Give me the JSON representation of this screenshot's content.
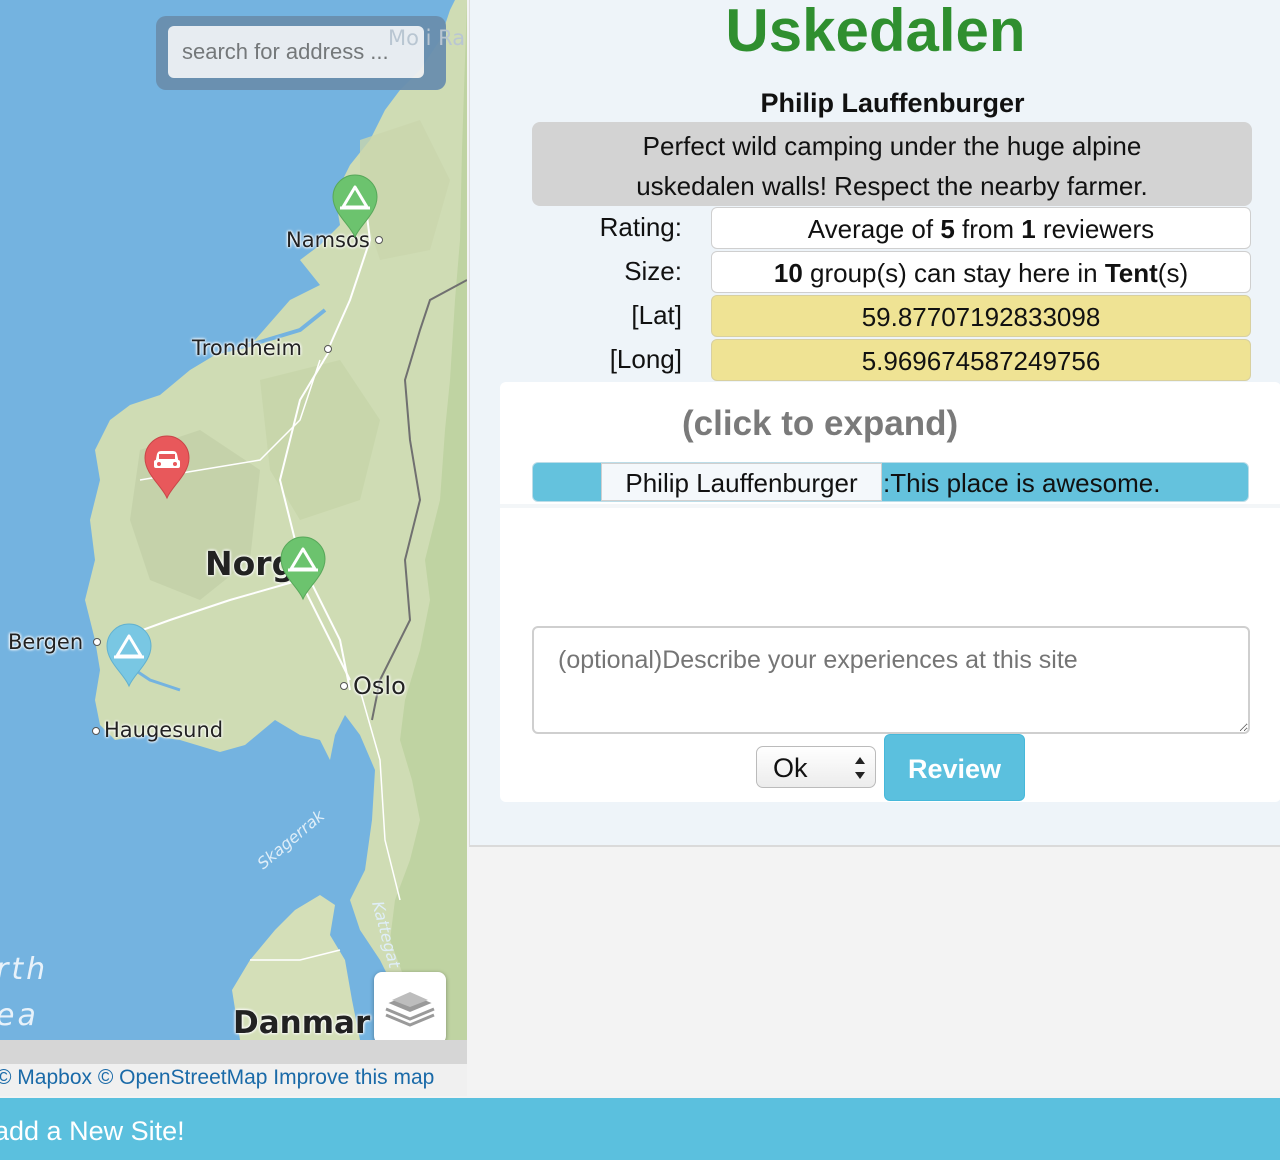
{
  "map": {
    "search_placeholder": "search for address ...",
    "labels": {
      "mo_i_ra": "Mo i Ra",
      "namsos": "Namsos",
      "trondheim": "Trondheim",
      "norge": "Norg",
      "bergen": "Bergen",
      "oslo": "Oslo",
      "haugesund": "Haugesund",
      "skagerrak": "Skagerrak",
      "kattegat": "Kattegat",
      "north": "rth",
      "sea": "ea",
      "danmark": "Danmar"
    },
    "markers": [
      {
        "name": "marker-namsos",
        "type": "tent-icon",
        "color": "#6cc36e"
      },
      {
        "name": "marker-uskedalen-selected",
        "type": "car-icon",
        "color": "#e8585b"
      },
      {
        "name": "marker-central",
        "type": "tent-icon",
        "color": "#6cc36e"
      },
      {
        "name": "marker-bergen",
        "type": "tent-icon",
        "color": "#79c7e3"
      }
    ],
    "attribution": {
      "mapbox": "© Mapbox",
      "osm": "© OpenStreetMap",
      "improve": "Improve this map"
    },
    "layers_icon": "layers-icon"
  },
  "site": {
    "title": "Uskedalen",
    "author": "Philip Lauffenburger",
    "description_line1": "Perfect wild camping under the huge alpine",
    "description_line2": "uskedalen walls! Respect the nearby farmer.",
    "rating_label": "Rating:",
    "rating_prefix": "Average of ",
    "rating_value": "5",
    "rating_mid": " from ",
    "rating_count": "1",
    "rating_suffix": " reviewers",
    "size_label": "Size:",
    "size_value": "10",
    "size_mid": " group(s) can stay here in ",
    "size_type": "Tent",
    "size_suffix": "(s)",
    "lat_label": "[Lat]",
    "lat_value": "59.87707192833098",
    "long_label": "[Long]",
    "long_value": "5.969674587249756"
  },
  "reviews": {
    "expand_label": "(click to expand)",
    "items": [
      {
        "reviewer": "Philip Lauffenburger",
        "text": ":This place is awesome."
      }
    ],
    "textarea_placeholder": "(optional)Describe your experiences at this site",
    "select_value": "Ok",
    "review_button": "Review"
  },
  "footer": {
    "add_site": "add a New Site!"
  },
  "colors": {
    "title_green": "#2f8f2f",
    "accent_blue": "#5bc0de",
    "lat_long_yellow": "#efe394"
  }
}
